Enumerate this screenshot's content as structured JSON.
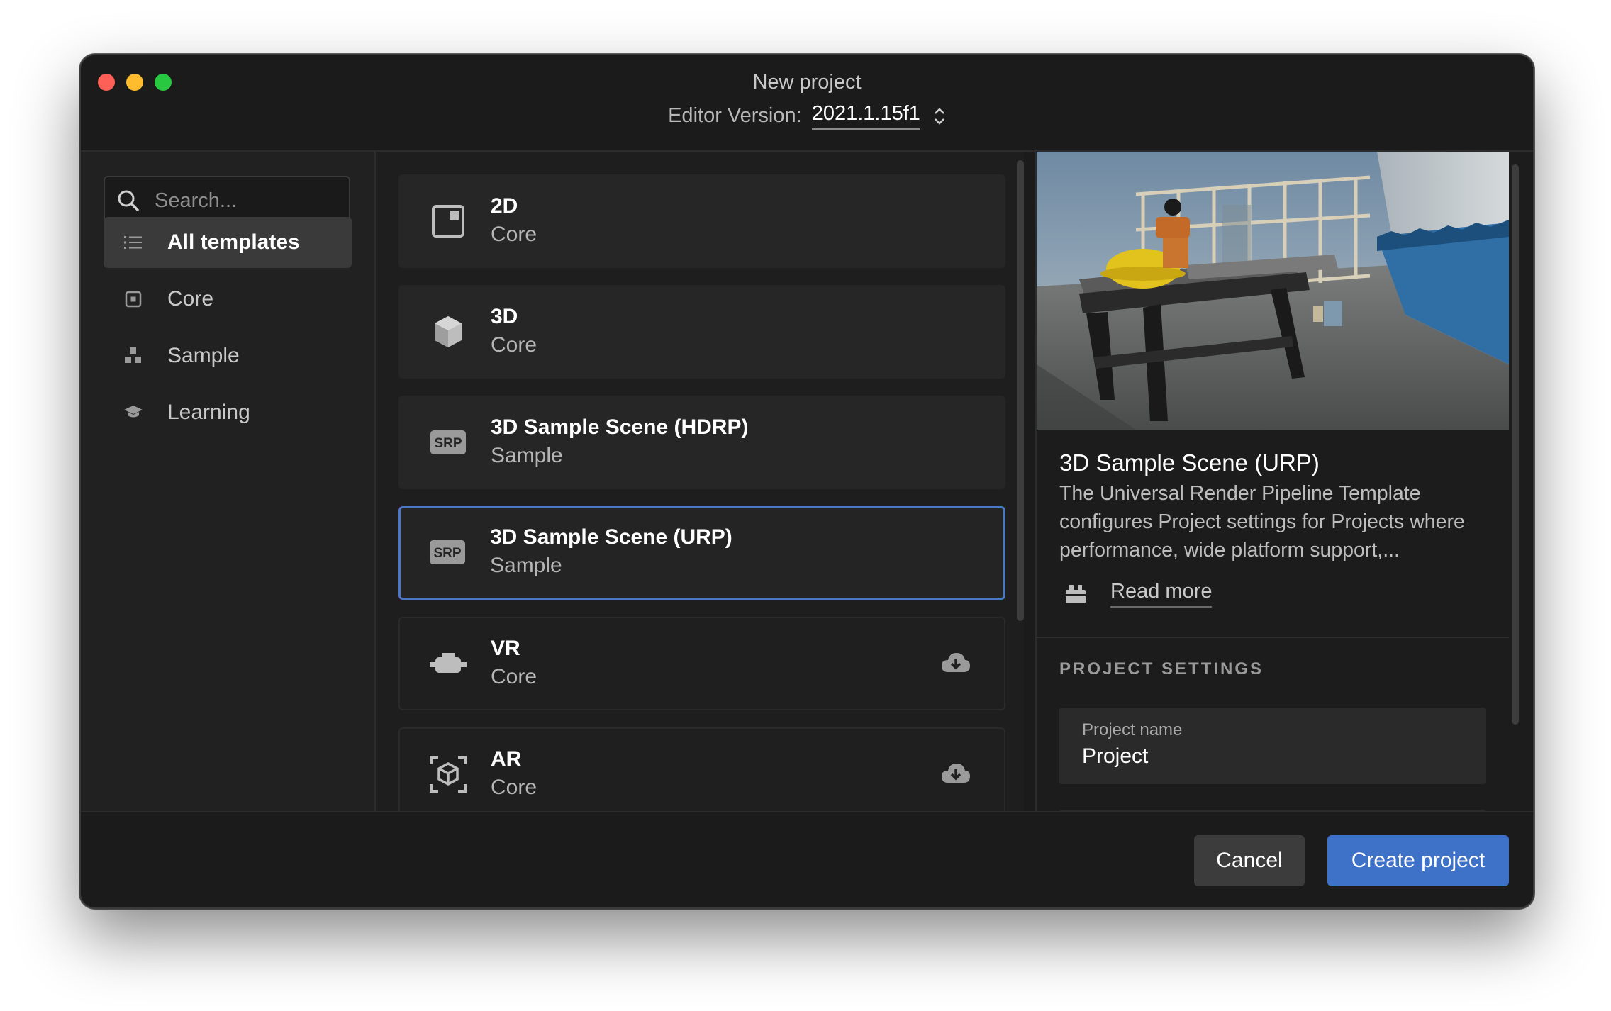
{
  "window": {
    "title": "New project",
    "version_label": "Editor Version:",
    "version_value": "2021.1.15f1"
  },
  "search": {
    "placeholder": "Search..."
  },
  "sidebar": {
    "items": [
      {
        "label": "All templates",
        "icon": "list-icon",
        "active": true
      },
      {
        "label": "Core",
        "icon": "core-icon",
        "active": false
      },
      {
        "label": "Sample",
        "icon": "sample-icon",
        "active": false
      },
      {
        "label": "Learning",
        "icon": "learning-icon",
        "active": false
      }
    ]
  },
  "templates": [
    {
      "title": "2D",
      "category": "Core",
      "icon": "2d-icon",
      "download": false,
      "selected": false
    },
    {
      "title": "3D",
      "category": "Core",
      "icon": "3d-cube-icon",
      "download": false,
      "selected": false
    },
    {
      "title": "3D Sample Scene (HDRP)",
      "category": "Sample",
      "icon": "srp-icon",
      "icon_text": "SRP",
      "download": false,
      "selected": false
    },
    {
      "title": "3D Sample Scene (URP)",
      "category": "Sample",
      "icon": "srp-icon",
      "icon_text": "SRP",
      "download": false,
      "selected": true
    },
    {
      "title": "VR",
      "category": "Core",
      "icon": "vr-headset-icon",
      "download": true,
      "selected": false
    },
    {
      "title": "AR",
      "category": "Core",
      "icon": "ar-cube-icon",
      "download": true,
      "selected": false
    }
  ],
  "detail": {
    "title": "3D Sample Scene (URP)",
    "description": "The Universal Render Pipeline Template configures Project settings for Projects where performance, wide platform support,...",
    "read_more": "Read more",
    "section_header": "PROJECT SETTINGS",
    "project_name_label": "Project name",
    "project_name_value": "Project"
  },
  "footer": {
    "cancel": "Cancel",
    "create": "Create project"
  },
  "colors": {
    "accent": "#3d72c8",
    "selection_border": "#4a78c8",
    "window_bg": "#1b1b1b"
  }
}
